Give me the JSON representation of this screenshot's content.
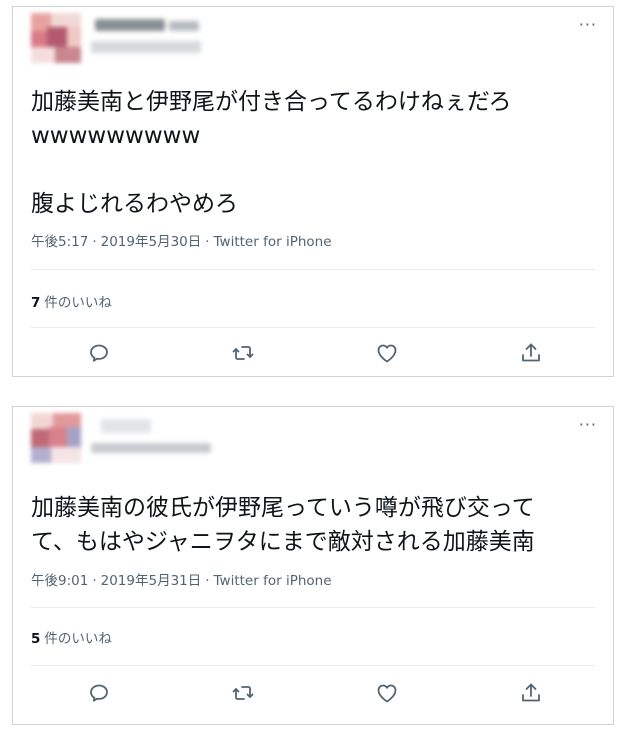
{
  "colors": {
    "text": "#0f1419",
    "muted": "#536471",
    "border": "#cfd4d8",
    "divider": "#e6ebee"
  },
  "icons": {
    "more": "more-horizontal-icon",
    "reply": "reply-icon",
    "retweet": "retweet-icon",
    "like": "heart-icon",
    "share": "share-icon"
  },
  "tweets": [
    {
      "more_label": "···",
      "body": "加藤美南と伊野尾が付き合ってるわけねぇだろ\nwwwwwwwww\n\n腹よじれるわやめろ",
      "time": "午後5:17",
      "separator": "·",
      "date": "2019年5月30日",
      "source": "Twitter for iPhone",
      "like_count": "7",
      "like_label": "件のいいね"
    },
    {
      "more_label": "···",
      "body": "加藤美南の彼氏が伊野尾っていう噂が飛び交って\nて、もはやジャニヲタにまで敵対される加藤美南",
      "time": "午後9:01",
      "separator": "·",
      "date": "2019年5月31日",
      "source": "Twitter for iPhone",
      "like_count": "5",
      "like_label": "件のいいね"
    }
  ]
}
